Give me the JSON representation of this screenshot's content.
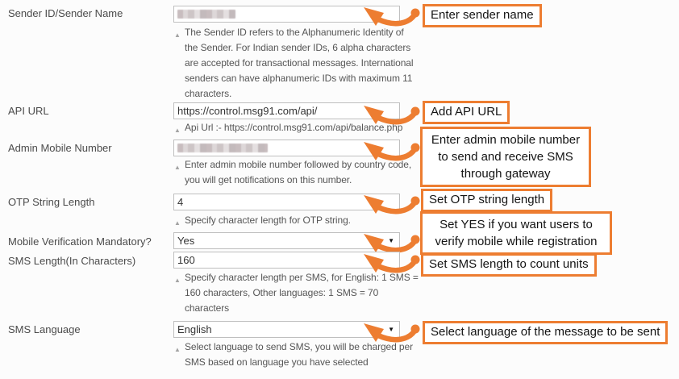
{
  "colors": {
    "accent": "#ED7D31"
  },
  "icons": {
    "help_marker": "▲",
    "dropdown_arrow": "▼"
  },
  "form": {
    "fields": [
      {
        "label": "Sender ID/Sender Name",
        "redacted": true,
        "help": "The Sender ID refers to the Alphanumeric Identity of the Sender. For Indian sender IDs, 6 alpha characters are accepted for transactional messages. International senders can have alphanumeric IDs with maximum 11 characters.",
        "callout": "Enter sender name"
      },
      {
        "label": "API URL",
        "value": "https://control.msg91.com/api/",
        "help": "Api Url :- https://control.msg91.com/api/balance.php",
        "callout": "Add API URL"
      },
      {
        "label": "Admin Mobile Number",
        "redacted": true,
        "help": "Enter admin mobile number followed by country code, you will get notifications on this number.",
        "callout": "Enter admin mobile number to send and receive SMS through gateway"
      },
      {
        "label": "OTP String Length",
        "value": "4",
        "help": "Specify character length for OTP string.",
        "callout": "Set OTP string length"
      },
      {
        "label": "Mobile Verification Mandatory?",
        "value": "Yes",
        "callout": "Set YES if you want users to verify mobile while registration"
      },
      {
        "label": "SMS Length(In Characters)",
        "value": "160",
        "help": "Specify character length per SMS, for English: 1 SMS = 160 characters, Other languages: 1 SMS = 70 characters",
        "callout": "Set SMS length to count units"
      },
      {
        "label": "SMS Language",
        "value": "English",
        "help": "Select language to send SMS, you will be charged per SMS based on language you have selected",
        "callout": "Select language of the message to be sent"
      }
    ]
  }
}
